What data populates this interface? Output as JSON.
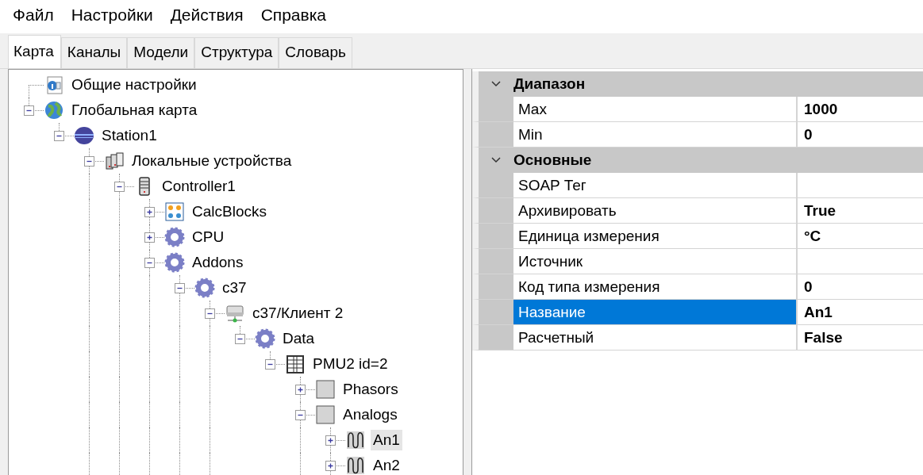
{
  "menu": [
    "Файл",
    "Настройки",
    "Действия",
    "Справка"
  ],
  "tabs": [
    {
      "label": "Карта",
      "selected": true
    },
    {
      "label": "Каналы",
      "selected": false
    },
    {
      "label": "Модели",
      "selected": false
    },
    {
      "label": "Структура",
      "selected": false
    },
    {
      "label": "Словарь",
      "selected": false
    }
  ],
  "tree": [
    {
      "label": "Общие настройки",
      "kind": "info",
      "selected": false
    },
    {
      "label": "Глобальная карта",
      "kind": "globe",
      "expanded": true,
      "selected": false,
      "children": [
        {
          "label": "Station1",
          "kind": "station",
          "expanded": true,
          "selected": false,
          "children": [
            {
              "label": "Локальные устройства",
              "kind": "devices",
              "expanded": true,
              "more_below": true,
              "selected": false,
              "children": [
                {
                  "label": "Controller1",
                  "kind": "server",
                  "expanded": true,
                  "more_below": true,
                  "selected": false,
                  "children": [
                    {
                      "label": "CalcBlocks",
                      "kind": "blocks",
                      "expanded": false,
                      "selected": false
                    },
                    {
                      "label": "CPU",
                      "kind": "gear",
                      "expanded": false,
                      "selected": false
                    },
                    {
                      "label": "Addons",
                      "kind": "gear",
                      "expanded": true,
                      "more_below": true,
                      "selected": false,
                      "children": [
                        {
                          "label": "c37",
                          "kind": "gear",
                          "expanded": true,
                          "more_below": true,
                          "selected": false,
                          "children": [
                            {
                              "label": "c37/Клиент 2",
                              "kind": "network",
                              "expanded": true,
                              "more_below": true,
                              "selected": false,
                              "children": [
                                {
                                  "label": "Data",
                                  "kind": "gear",
                                  "expanded": true,
                                  "selected": false,
                                  "children": [
                                    {
                                      "label": "PMU2 id=2",
                                      "kind": "table",
                                      "expanded": true,
                                      "selected": false,
                                      "children": [
                                        {
                                          "label": "Phasors",
                                          "kind": "folder",
                                          "expanded": false,
                                          "selected": false
                                        },
                                        {
                                          "label": "Analogs",
                                          "kind": "folder",
                                          "expanded": true,
                                          "more_below": true,
                                          "selected": false,
                                          "children": [
                                            {
                                              "label": "An1",
                                              "kind": "wave",
                                              "expanded": false,
                                              "selected": true
                                            },
                                            {
                                              "label": "An2",
                                              "kind": "wave",
                                              "expanded": false,
                                              "more_below": true,
                                              "selected": false
                                            }
                                          ]
                                        }
                                      ]
                                    }
                                  ]
                                }
                              ]
                            }
                          ]
                        }
                      ]
                    }
                  ]
                }
              ]
            }
          ]
        }
      ]
    }
  ],
  "properties": [
    {
      "category": "Диапазон",
      "expanded": true,
      "rows": [
        {
          "name": "Max",
          "value": "1000",
          "selected": false
        },
        {
          "name": "Min",
          "value": "0",
          "selected": false
        }
      ]
    },
    {
      "category": "Основные",
      "expanded": true,
      "rows": [
        {
          "name": "SOAP Тег",
          "selected": false
        },
        {
          "name": "Архивировать",
          "value": "True",
          "selected": false
        },
        {
          "name": "Единица измерения",
          "value": "°C",
          "selected": false
        },
        {
          "name": "Источник",
          "selected": false
        },
        {
          "name": "Код типа измерения",
          "value": "0",
          "selected": false
        },
        {
          "name": "Название",
          "value": "An1",
          "selected": true
        },
        {
          "name": "Расчетный",
          "value": "False",
          "selected": false
        }
      ]
    }
  ]
}
